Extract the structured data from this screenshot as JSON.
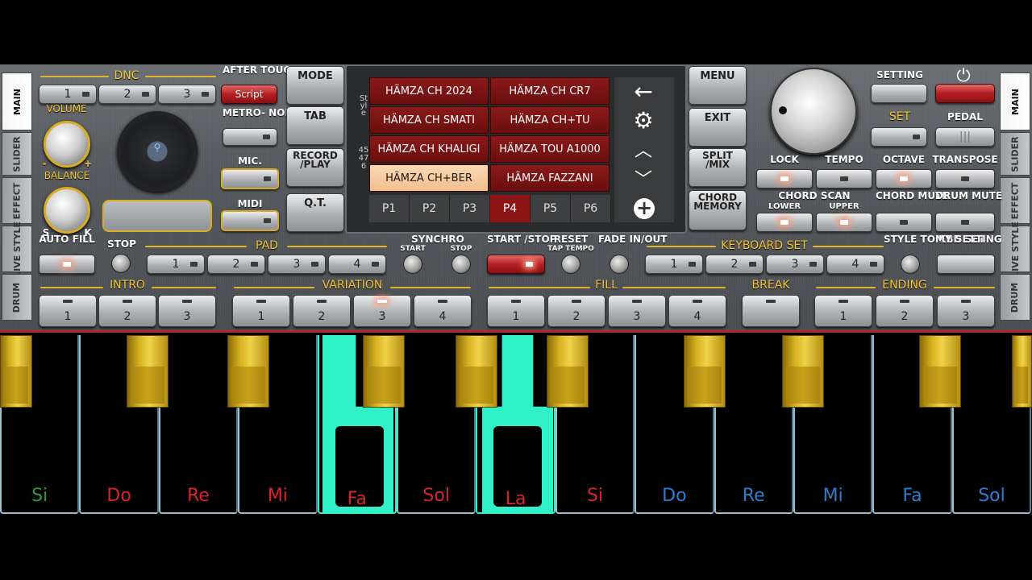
{
  "side_left": [
    "MAIN",
    "SLIDER",
    "EFFECT",
    "LIVE STYLE",
    "DRUM"
  ],
  "side_right": [
    "MAIN",
    "SLIDER",
    "EFFECT",
    "LIVE STYLE",
    "DRUM"
  ],
  "dnc": {
    "label": "DNC",
    "buttons": [
      "1",
      "2",
      "3"
    ]
  },
  "after_touch": {
    "label": "AFTER TOUCH",
    "button": "Script"
  },
  "volume": {
    "label": "VOLUME",
    "minus": "-",
    "plus": "+"
  },
  "balance": {
    "label": "BALANCE",
    "s": "S",
    "k": "K"
  },
  "metronome": {
    "label": "METRO- NOME"
  },
  "mic": {
    "label": "MIC."
  },
  "midi": {
    "label": "MIDI"
  },
  "mode_col": {
    "mode": "MODE",
    "tab": "TAB",
    "record": "RECORD /PLAY",
    "qt": "Q.T."
  },
  "screen": {
    "side_label": "Style",
    "side_nums": "45 476",
    "styles": [
      "HÄMZA CH 2024",
      "HÄMZA CH CR7",
      "HÄMZA CH SMATI",
      "HÄMZA CH+TU",
      "HÄMZA CH KHALIGI",
      "HÄMZA TOU A1000",
      "HÄMZA CH+BER",
      "HÄMZA FAZZANI"
    ],
    "selected_style": "HÄMZA CH+BER",
    "pages": [
      "P1",
      "P2",
      "P3",
      "P4",
      "P5",
      "P6"
    ],
    "selected_page": "P4"
  },
  "menu_col": {
    "menu": "MENU",
    "exit": "EXIT",
    "split": "SPLIT /MIX",
    "chord_memory": "CHORD MEMORY"
  },
  "right": {
    "setting": "SETTING",
    "set": "SET",
    "pedal": "PEDAL",
    "lock": "LOCK",
    "tempo": "TEMPO",
    "octave": "OCTAVE",
    "transpose": "TRANSPOSE",
    "chord_scan": "CHORD SCAN",
    "lower": "LOWER",
    "upper": "UPPER",
    "chord_mute": "CHORD MUTE",
    "drum_mute": "DRUM MUTE"
  },
  "row3": {
    "auto_fill": "AUTO FILL",
    "stop": "STOP",
    "pad": "PAD",
    "pad_buttons": [
      "1",
      "2",
      "3",
      "4"
    ],
    "synchro": "SYNCHRO",
    "synchro_start": "START",
    "synchro_stop": "STOP",
    "start_stop": "START /STOP",
    "reset": "RESET",
    "tap_tempo": "TAP TEMPO",
    "fade": "FADE IN/OUT",
    "keyboard_set": "KEYBOARD SET",
    "kbd_buttons": [
      "1",
      "2",
      "3",
      "4"
    ],
    "style_to_kbd": "STYLE TO KBD SET",
    "my_setting": "MY SETTING"
  },
  "sections": {
    "intro": {
      "label": "INTRO",
      "buttons": [
        "1",
        "2",
        "3"
      ]
    },
    "variation": {
      "label": "VARIATION",
      "buttons": [
        "1",
        "2",
        "3",
        "4"
      ]
    },
    "fill": {
      "label": "FILL",
      "buttons": [
        "1",
        "2",
        "3",
        "4"
      ]
    },
    "break": {
      "label": "BREAK"
    },
    "ending": {
      "label": "ENDING",
      "buttons": [
        "1",
        "2",
        "3"
      ]
    }
  },
  "keys": [
    "Si",
    "Do",
    "Re",
    "Mi",
    "Fa",
    "Sol",
    "La",
    "Si",
    "Do",
    "Re",
    "Mi",
    "Fa",
    "Sol"
  ],
  "key_colors": [
    "#2e9a3a",
    "#d8242a",
    "#d8242a",
    "#d8242a",
    "#d8242a",
    "#d8242a",
    "#d8242a",
    "#d8242a",
    "#2c7fd0",
    "#2c7fd0",
    "#2c7fd0",
    "#2c7fd0",
    "#2c7fd0"
  ],
  "pressed_keys": [
    "Fa",
    "La"
  ]
}
